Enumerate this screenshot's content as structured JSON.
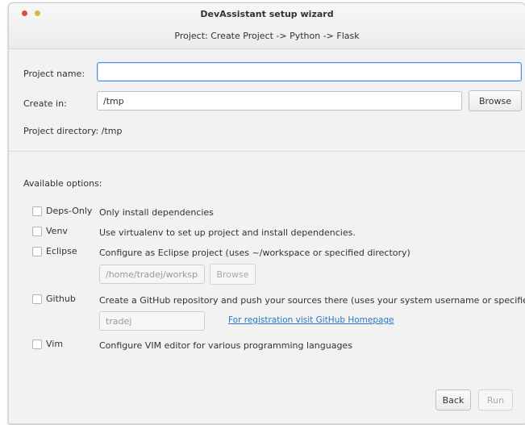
{
  "window": {
    "title": "DevAssistant setup wizard",
    "subtitle": "Project: Create Project -> Python -> Flask"
  },
  "form": {
    "project_name_label": "Project name:",
    "project_name_value": "",
    "create_in_label": "Create in:",
    "create_in_value": "/tmp",
    "browse_label": "Browse",
    "project_directory_label": "Project directory:",
    "project_directory_value": "/tmp"
  },
  "options": {
    "heading": "Available options:",
    "items": [
      {
        "name": "Deps-Only",
        "description": "Only install dependencies",
        "checked": false
      },
      {
        "name": "Venv",
        "description": "Use virtualenv to set up project and install dependencies.",
        "checked": false
      },
      {
        "name": "Eclipse",
        "description": "Configure as Eclipse project (uses ~/workspace or specified directory)",
        "checked": false
      },
      {
        "name": "Github",
        "description": "Create a GitHub repository and push your sources there (uses your system username or specified name)",
        "checked": false
      },
      {
        "name": "Vim",
        "description": "Configure VIM editor for various programming languages",
        "checked": false
      }
    ],
    "eclipse_path_value": "/home/tradej/workspac",
    "eclipse_browse_label": "Browse",
    "github_user_value": "tradej",
    "github_link": "For registration visit GitHub Homepage"
  },
  "footer": {
    "back_label": "Back",
    "run_label": "Run"
  },
  "colors": {
    "accent": "#4a90d9",
    "link": "#2a76c6",
    "close": "#e04a43",
    "minimize": "#e0b43a"
  }
}
